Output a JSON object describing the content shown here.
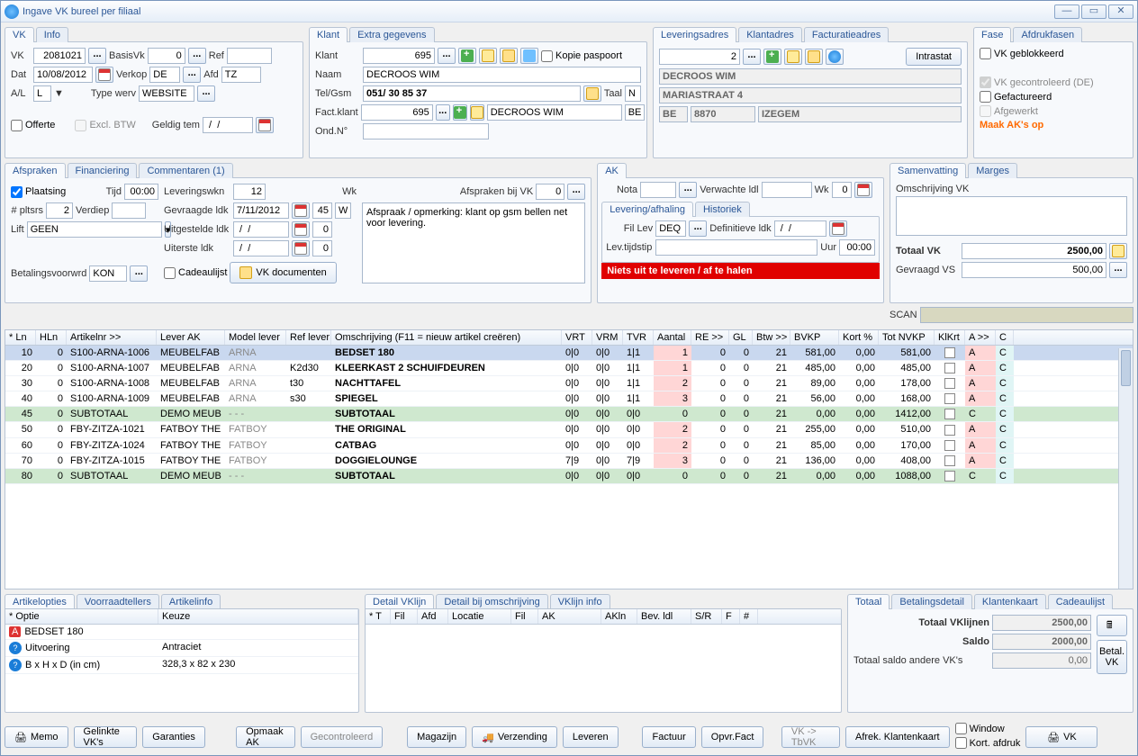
{
  "window": {
    "title": "Ingave VK bureel per filiaal"
  },
  "vk_tab": {
    "tabs": [
      "VK",
      "Info"
    ],
    "vk_lbl": "VK",
    "vk": "2081021",
    "basisVk_lbl": "BasisVk",
    "basisVk": "0",
    "ref_lbl": "Ref",
    "ref": "",
    "dat_lbl": "Dat",
    "dat": "10/08/2012",
    "verkop_lbl": "Verkop",
    "verkop": "DE",
    "afd_lbl": "Afd",
    "afd": "TZ",
    "al_lbl": "A/L",
    "al": "L",
    "arrow": "▼",
    "typewerv_lbl": "Type werv",
    "typewerv": "WEBSITE",
    "offerte_lbl": "Offerte",
    "exclbtw_lbl": "Excl. BTW",
    "geldig_lbl": "Geldig tem",
    "geldig": " /  / "
  },
  "klant": {
    "tabs": [
      "Klant",
      "Extra gegevens"
    ],
    "klant_lbl": "Klant",
    "klant": "695",
    "kopie_lbl": "Kopie paspoort",
    "naam_lbl": "Naam",
    "naam": "DECROOS WIM",
    "tel_lbl": "Tel/Gsm",
    "tel": "051/ 30 85 37",
    "taal_lbl": "Taal",
    "taal": "N",
    "factklant_lbl": "Fact.klant",
    "factklant": "695",
    "factklant_name": "DECROOS WIM",
    "taal2": "BE",
    "ondn_lbl": "Ond.N°",
    "ondn": ""
  },
  "lever": {
    "tabs": [
      "Leveringsadres",
      "Klantadres",
      "Facturatieadres"
    ],
    "num": "2",
    "intrastat": "Intrastat",
    "naam": "DECROOS WIM",
    "straat": "MARIASTRAAT 4",
    "land": "BE",
    "post": "8870",
    "stad": "IZEGEM"
  },
  "fase": {
    "tabs": [
      "Fase",
      "Afdrukfasen"
    ],
    "geblokkeerd": "VK geblokkeerd",
    "gecontroleerd": "VK gecontroleerd (DE)",
    "gefactureerd": "Gefactureerd",
    "afgewerkt": "Afgewerkt",
    "maakak": "Maak AK's op"
  },
  "afspraken": {
    "tabs": [
      "Afspraken",
      "Financiering",
      "Commentaren (1)"
    ],
    "plaatsing_lbl": "Plaatsing",
    "tijd_lbl": "Tijd",
    "tijd": "00:00",
    "pltsrs_lbl": "# pltsrs",
    "pltsrs": "2",
    "verdiep_lbl": "Verdiep",
    "verdiep": "",
    "lift_lbl": "Lift",
    "lift": "GEEN",
    "leveringswkn_lbl": "Leveringswkn",
    "leveringswkn": "12",
    "wk_lbl": "Wk",
    "gevraagde_lbl": "Gevraagde ldk",
    "gevraagde": "7/11/2012",
    "gevraagde_wk": "45",
    "gevraagde_w": "W",
    "uitgestelde_lbl": "Uitgestelde ldk",
    "uitgestelde": " /  / ",
    "uitgestelde_wk": "0",
    "uiterste_lbl": "Uiterste ldk",
    "uiterste": " /  / ",
    "uiterste_wk": "0",
    "cadeaulijst_lbl": "Cadeaulijst",
    "vkdoc": "VK documenten",
    "betaling_lbl": "Betalingsvoorwrd",
    "betaling": "KON",
    "afspraak_lbl": "Afspraken bij VK",
    "afspraak_num": "0",
    "opmerking_lbl": "Afspraak / opmerking: klant op gsm bellen net voor levering."
  },
  "ak": {
    "tab": "AK",
    "nota_lbl": "Nota",
    "nota": "",
    "verwachte_lbl": "Verwachte ldl",
    "verwachte": "",
    "wk_lbl": "Wk",
    "wk": "0",
    "subtabs": [
      "Levering/afhaling",
      "Historiek"
    ],
    "fillev_lbl": "Fil Lev",
    "fillev": "DEQ",
    "def_lbl": "Definitieve ldk",
    "def": " /  / ",
    "levtijd_lbl": "Lev.tijdstip",
    "levtijd": "",
    "uur_lbl": "Uur",
    "uur": "00:00",
    "redbar": "Niets uit te leveren / af te halen"
  },
  "samen": {
    "tabs": [
      "Samenvatting",
      "Marges"
    ],
    "omschr_lbl": "Omschrijving VK",
    "omschr": "",
    "totaal_lbl": "Totaal VK",
    "totaal": "2500,00",
    "gevraagd_lbl": "Gevraagd VS",
    "gevraagd": "500,00",
    "scan_lbl": "SCAN"
  },
  "grid": {
    "headers": [
      "* Ln",
      "HLn",
      "Artikelnr >>",
      "Lever AK",
      "Model lever",
      "Ref lever",
      "Omschrijving (F11 = nieuw artikel creëren)",
      "VRT",
      "VRM",
      "TVR",
      "Aantal",
      "RE >>",
      "GL",
      "Btw >>",
      "BVKP",
      "Kort %",
      "Tot NVKP",
      "KlKrt",
      "A >>",
      "C"
    ],
    "rows": [
      {
        "sel": true,
        "ln": "10",
        "hln": "0",
        "art": "S100-ARNA-1006",
        "lever": "MEUBELFAB",
        "model_gray": "ARNA",
        "ref": "",
        "omsch": "BEDSET 180",
        "vrt": "0|0",
        "vrm": "0|0",
        "tvr": "1|1",
        "aantal": "1",
        "re": "0",
        "gl": "0",
        "btw": "21",
        "bvkp": "581,00",
        "kort": "0,00",
        "tot": "581,00",
        "a": "A",
        "c": "C"
      },
      {
        "ln": "20",
        "hln": "0",
        "art": "S100-ARNA-1007",
        "lever": "MEUBELFAB",
        "model_gray": "ARNA",
        "ref": "K2d30",
        "omsch": "KLEERKAST 2 SCHUIFDEUREN",
        "vrt": "0|0",
        "vrm": "0|0",
        "tvr": "1|1",
        "aantal": "1",
        "re": "0",
        "gl": "0",
        "btw": "21",
        "bvkp": "485,00",
        "kort": "0,00",
        "tot": "485,00",
        "a": "A",
        "c": "C"
      },
      {
        "ln": "30",
        "hln": "0",
        "art": "S100-ARNA-1008",
        "lever": "MEUBELFAB",
        "model_gray": "ARNA",
        "ref": "t30",
        "omsch": "NACHTTAFEL",
        "vrt": "0|0",
        "vrm": "0|0",
        "tvr": "1|1",
        "aantal": "2",
        "re": "0",
        "gl": "0",
        "btw": "21",
        "bvkp": "89,00",
        "kort": "0,00",
        "tot": "178,00",
        "a": "A",
        "c": "C"
      },
      {
        "ln": "40",
        "hln": "0",
        "art": "S100-ARNA-1009",
        "lever": "MEUBELFAB",
        "model_gray": "ARNA",
        "ref": "s30",
        "omsch": "SPIEGEL",
        "vrt": "0|0",
        "vrm": "0|0",
        "tvr": "1|1",
        "aantal": "3",
        "re": "0",
        "gl": "0",
        "btw": "21",
        "bvkp": "56,00",
        "kort": "0,00",
        "tot": "168,00",
        "a": "A",
        "c": "C"
      },
      {
        "sub": true,
        "ln": "45",
        "hln": "0",
        "art": "SUBTOTAAL",
        "lever": "DEMO MEUB",
        "model_gray": "- - -",
        "ref": "",
        "omsch": "SUBTOTAAL",
        "vrt": "0|0",
        "vrm": "0|0",
        "tvr": "0|0",
        "aantal": "0",
        "re": "0",
        "gl": "0",
        "btw": "21",
        "bvkp": "0,00",
        "kort": "0,00",
        "tot": "1412,00",
        "a": "C",
        "c": "C"
      },
      {
        "ln": "50",
        "hln": "0",
        "art": "FBY-ZITZA-1021",
        "lever": "FATBOY THE",
        "model_gray": "FATBOY",
        "ref": "",
        "omsch": "THE ORIGINAL",
        "vrt": "0|0",
        "vrm": "0|0",
        "tvr": "0|0",
        "aantal": "2",
        "re": "0",
        "gl": "0",
        "btw": "21",
        "bvkp": "255,00",
        "kort": "0,00",
        "tot": "510,00",
        "a": "A",
        "c": "C"
      },
      {
        "ln": "60",
        "hln": "0",
        "art": "FBY-ZITZA-1024",
        "lever": "FATBOY THE",
        "model_gray": "FATBOY",
        "ref": "",
        "omsch": "CATBAG",
        "vrt": "0|0",
        "vrm": "0|0",
        "tvr": "0|0",
        "aantal": "2",
        "re": "0",
        "gl": "0",
        "btw": "21",
        "bvkp": "85,00",
        "kort": "0,00",
        "tot": "170,00",
        "a": "A",
        "c": "C"
      },
      {
        "ln": "70",
        "hln": "0",
        "art": "FBY-ZITZA-1015",
        "lever": "FATBOY THE",
        "model_gray": "FATBOY",
        "ref": "",
        "omsch": "DOGGIELOUNGE",
        "vrt": "7|9",
        "vrm": "0|0",
        "tvr": "7|9",
        "aantal": "3",
        "re": "0",
        "gl": "0",
        "btw": "21",
        "bvkp": "136,00",
        "kort": "0,00",
        "tot": "408,00",
        "a": "A",
        "c": "C"
      },
      {
        "sub": true,
        "ln": "80",
        "hln": "0",
        "art": "SUBTOTAAL",
        "lever": "DEMO MEUB",
        "model_gray": "- - -",
        "ref": "",
        "omsch": "SUBTOTAAL",
        "vrt": "0|0",
        "vrm": "0|0",
        "tvr": "0|0",
        "aantal": "0",
        "re": "0",
        "gl": "0",
        "btw": "21",
        "bvkp": "0,00",
        "kort": "0,00",
        "tot": "1088,00",
        "a": "C",
        "c": "C"
      }
    ]
  },
  "artikelopties": {
    "tabs": [
      "Artikelopties",
      "Voorraadtellers",
      "Artikelinfo"
    ],
    "head_optie": "* Optie",
    "head_keuze": "Keuze",
    "rows": [
      {
        "icon": "A",
        "label": "BEDSET 180",
        "val": ""
      },
      {
        "icon": "?",
        "label": "Uitvoering",
        "val": "Antraciet"
      },
      {
        "icon": "?",
        "label": "B x H x D (in cm)",
        "val": "328,3 x 82 x 230"
      }
    ]
  },
  "detail": {
    "tabs": [
      "Detail VKlijn",
      "Detail bij omschrijving",
      "VKlijn info"
    ],
    "headers": [
      "* T",
      "Fil",
      "Afd",
      "Locatie",
      "Fil",
      "AK",
      "AKln",
      "Bev. ldl",
      "S/R",
      "F",
      "#"
    ]
  },
  "totaal": {
    "tabs": [
      "Totaal",
      "Betalingsdetail",
      "Klantenkaart",
      "Cadeaulijst"
    ],
    "tv_lbl": "Totaal VKlijnen",
    "tv": "2500,00",
    "saldo_lbl": "Saldo",
    "saldo": "2000,00",
    "andere_lbl": "Totaal saldo andere VK's",
    "andere": "0,00",
    "betalvk": "Betal.\nVK",
    "afrek": "Afrek. Klantenkaart"
  },
  "footer": {
    "memo": "Memo",
    "gelinkte": "Gelinkte VK's",
    "garanties": "Garanties",
    "opmaak": "Opmaak AK",
    "gecontroleerd": "Gecontroleerd",
    "magazijn": "Magazijn",
    "verzending": "Verzending",
    "leveren": "Leveren",
    "factuur": "Factuur",
    "opvr": "Opvr.Fact",
    "vktbvk": "VK -> TbVK",
    "window_chk": "Window",
    "kort_chk": "Kort. afdruk",
    "vk_btn": "VK"
  }
}
